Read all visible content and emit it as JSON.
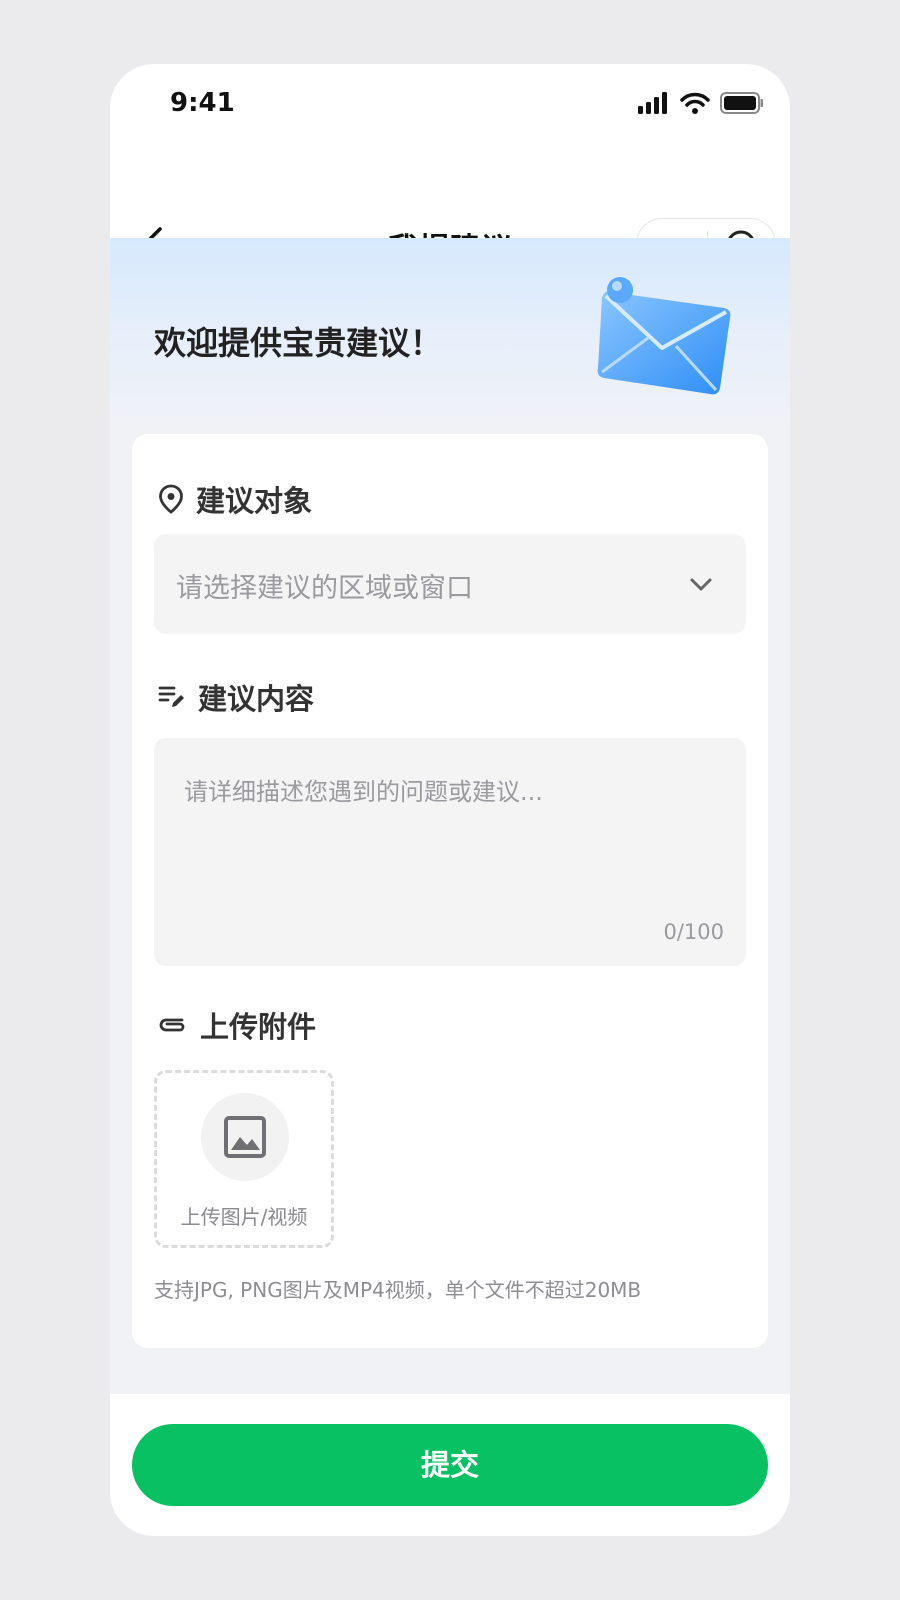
{
  "status_bar": {
    "time": "9:41"
  },
  "nav": {
    "title": "我提建议"
  },
  "hero": {
    "title": "欢迎提供宝贵建议！"
  },
  "form": {
    "target": {
      "label": "建议对象",
      "placeholder": "请选择建议的区域或窗口"
    },
    "content": {
      "label": "建议内容",
      "placeholder": "请详细描述您遇到的问题或建议...",
      "counter": "0/100"
    },
    "attachment": {
      "label": "上传附件",
      "upload_label": "上传图片/视频",
      "hint": "支持JPG, PNG图片及MP4视频，单个文件不超过20MB"
    }
  },
  "footer": {
    "submit_label": "提交"
  },
  "colors": {
    "primary": "#08c162",
    "hero_top": "#d6e9fd",
    "input_bg": "#f4f4f5"
  },
  "icons": [
    "signal-icon",
    "wifi-icon",
    "battery-icon",
    "back-icon",
    "more-icon",
    "record-icon",
    "envelope-icon",
    "location-pin-icon",
    "edit-list-icon",
    "chevron-down-icon",
    "paperclip-icon",
    "image-icon"
  ]
}
